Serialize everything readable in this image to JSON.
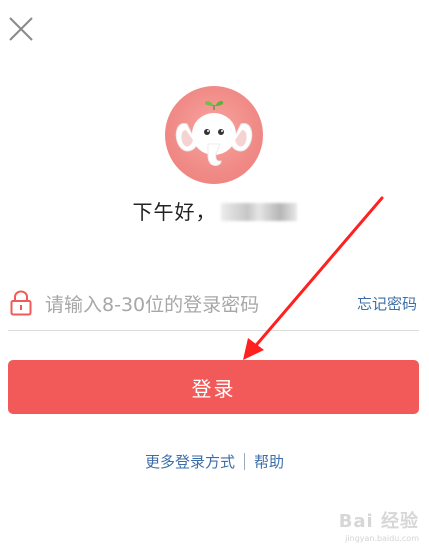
{
  "header": {
    "close_icon": "close-icon"
  },
  "profile": {
    "avatar_icon": "elephant-avatar",
    "greeting": "下午好，",
    "masked_name": ""
  },
  "password": {
    "placeholder": "请输入8-30位的登录密码",
    "value": "",
    "lock_icon": "lock-icon",
    "forgot_label": "忘记密码"
  },
  "actions": {
    "login_label": "登录"
  },
  "footer": {
    "more_login_label": "更多登录方式",
    "help_label": "帮助"
  },
  "annotation": {
    "arrow_color": "#ff2020"
  },
  "watermark": {
    "main": "Bai 经验",
    "sub": "jingyan.baidu.com"
  },
  "colors": {
    "accent": "#f25a5a",
    "link": "#3d6ea8",
    "lock": "#f25a5a"
  }
}
